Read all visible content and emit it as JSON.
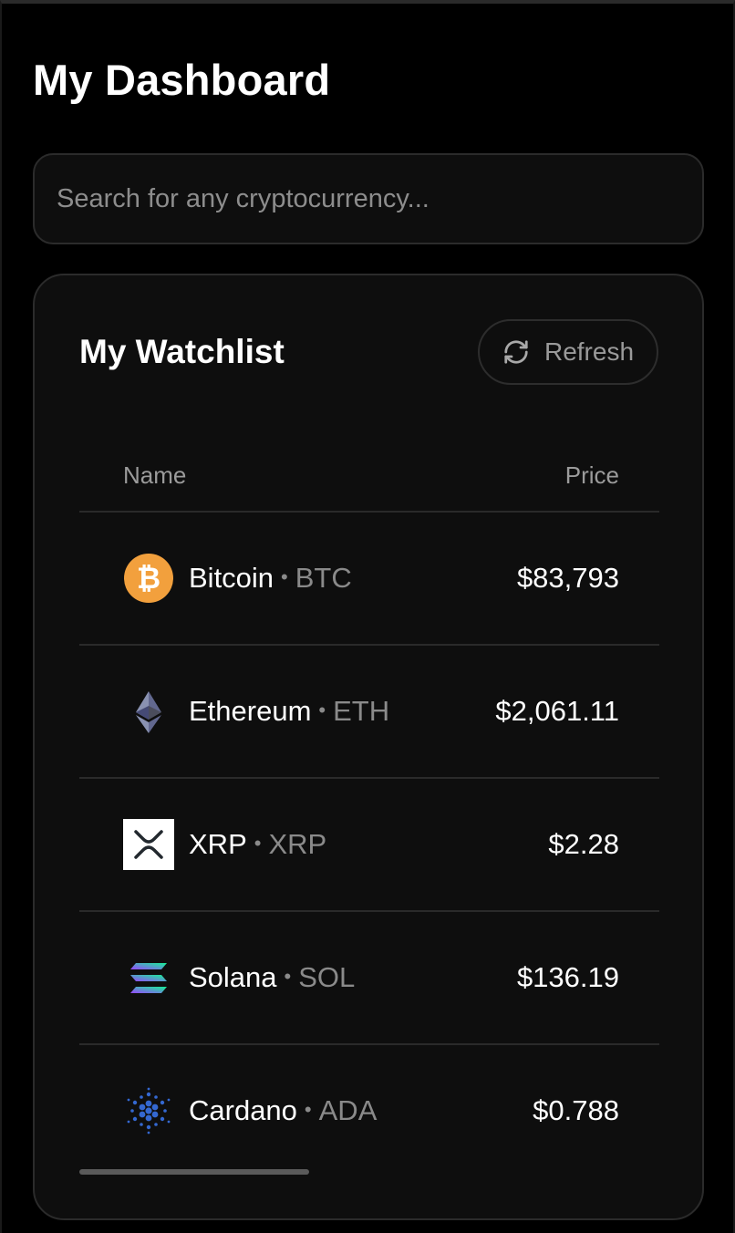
{
  "header": {
    "title": "My Dashboard"
  },
  "search": {
    "placeholder": "Search for any cryptocurrency...",
    "value": ""
  },
  "watchlist": {
    "title": "My Watchlist",
    "refresh_label": "Refresh",
    "refresh_icon": "refresh-icon",
    "columns": {
      "name": "Name",
      "price": "Price"
    },
    "rows": [
      {
        "name": "Bitcoin",
        "separator": "•",
        "symbol": "BTC",
        "price": "$83,793",
        "icon": "bitcoin-icon",
        "color": "#F2A03D"
      },
      {
        "name": "Ethereum",
        "separator": "•",
        "symbol": "ETH",
        "price": "$2,061.11",
        "icon": "ethereum-icon",
        "color": "#8A92B2"
      },
      {
        "name": "XRP",
        "separator": "•",
        "symbol": "XRP",
        "price": "$2.28",
        "icon": "xrp-icon",
        "color": "#23292F"
      },
      {
        "name": "Solana",
        "separator": "•",
        "symbol": "SOL",
        "price": "$136.19",
        "icon": "solana-icon",
        "color": "#9945FF"
      },
      {
        "name": "Cardano",
        "separator": "•",
        "symbol": "ADA",
        "price": "$0.788",
        "icon": "cardano-icon",
        "color": "#3468D1"
      }
    ]
  },
  "colors": {
    "background": "#000000",
    "card": "#0e0e0e",
    "border": "#2b2b2b",
    "muted_text": "#8a8a8a"
  }
}
